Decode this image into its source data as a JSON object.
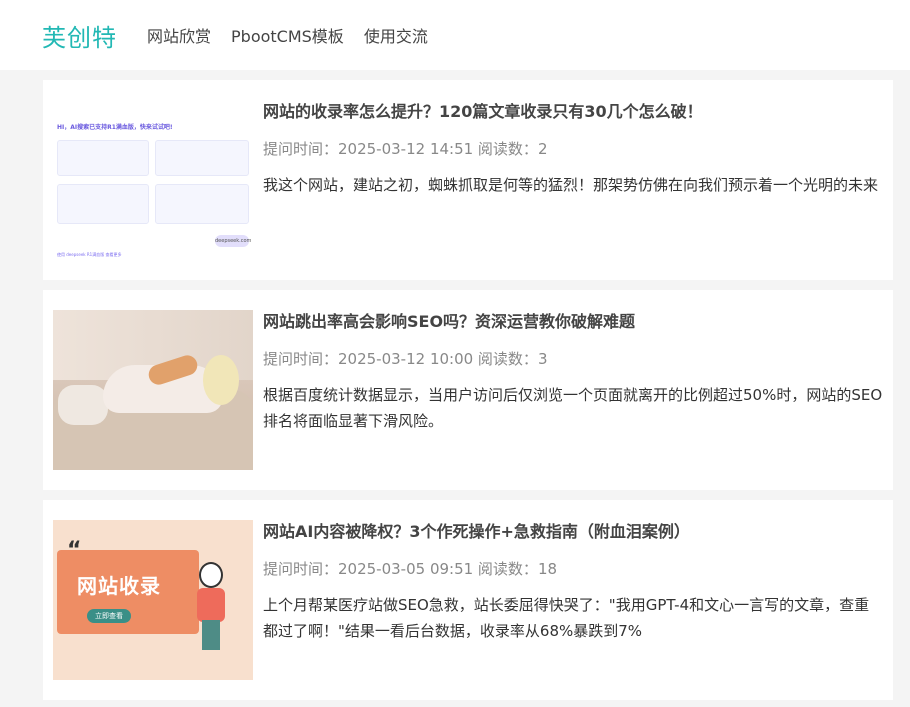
{
  "header": {
    "logo": "芙创特",
    "nav": [
      {
        "label": "网站欣赏"
      },
      {
        "label": "PbootCMS模板"
      },
      {
        "label": "使用交流"
      }
    ]
  },
  "articles": [
    {
      "title": "网站的收录率怎么提升？120篇文章收录只有30几个怎么破！",
      "meta": "提问时间：2025-03-12 14:51 阅读数：2",
      "desc": "我这个网站，建站之初，蜘蛛抓取是何等的猛烈！那架势仿佛在向我们预示着一个光明的未来",
      "thumb": {
        "header": "HI，AI搜索已支持R1满血版，快来试试吧!",
        "button": "deepseek.com",
        "footer": "使用 deepseek R1满血版 查看更多"
      }
    },
    {
      "title": "网站跳出率高会影响SEO吗？资深运营教你破解难题",
      "meta": "提问时间：2025-03-12 10:00 阅读数：3",
      "desc": "根据百度统计数据显示，当用户访问后仅浏览一个页面就离开的比例超过50%时，网站的SEO排名将面临显著下滑风险。"
    },
    {
      "title": "网站AI内容被降权？3个作死操作+急救指南（附血泪案例）",
      "meta": "提问时间：2025-03-05 09:51 阅读数：18",
      "desc": "上个月帮某医疗站做SEO急救，站长委屈得快哭了：\"我用GPT-4和文心一言写的文章，查重都过了啊！\"结果一看后台数据，收录率从68%暴跌到7%",
      "thumb": {
        "quote": "“",
        "headline": "网站收录",
        "cta": "立即查看"
      }
    }
  ]
}
